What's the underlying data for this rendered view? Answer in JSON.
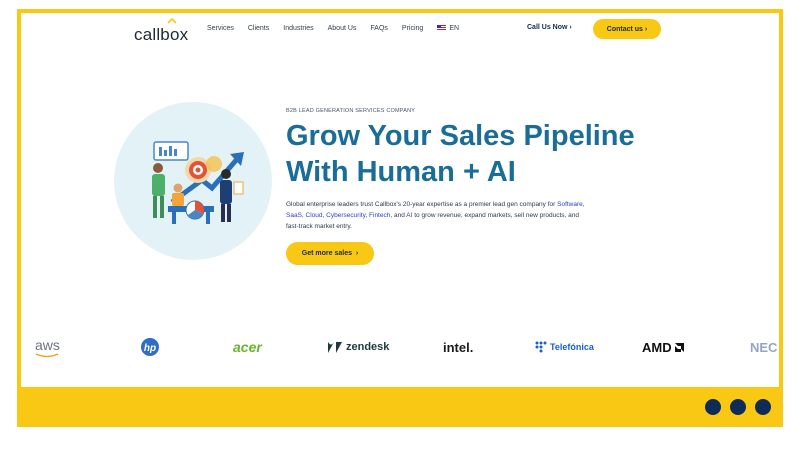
{
  "header": {
    "logo_text": "callbox",
    "nav": [
      "Services",
      "Clients",
      "Industries",
      "About Us",
      "FAQs",
      "Pricing"
    ],
    "language": "EN",
    "call_label": "Call Us Now",
    "contact_label": "Contact us"
  },
  "hero": {
    "eyebrow": "B2B LEAD GENERATION SERVICES COMPANY",
    "title_line1": "Grow Your Sales Pipeline",
    "title_line2": "With Human + AI",
    "desc_parts": [
      "Global enterprise leaders trust Callbox's 20-year expertise as a premier lead gen company for ",
      "Software",
      ", ",
      "SaaS",
      ", ",
      "Cloud",
      ", ",
      "Cybersecurity",
      ", ",
      "Fintech",
      ", and ",
      "AI",
      " to grow revenue, expand markets, sell new products, and fast-track market entry."
    ],
    "cta_label": "Get more sales"
  },
  "client_logos": [
    "aws",
    "hp",
    "acer",
    "zendesk",
    "intel.",
    "Telefónica",
    "AMD",
    "NEC"
  ],
  "colors": {
    "accent_yellow": "#f8c814",
    "title_blue": "#1a6d96",
    "navy": "#0f2b57",
    "link_blue": "#2b3fcc"
  }
}
